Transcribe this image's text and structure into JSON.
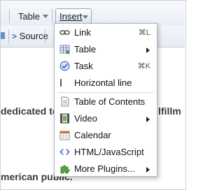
{
  "toolbar": {
    "table_label": "Table",
    "insert_label": "Insert",
    "source_label": "Source"
  },
  "document": {
    "line1_left": "dedicated to",
    "line1_right": "lfillm",
    "line2": "merican public."
  },
  "menu": {
    "items": [
      {
        "label": "Link",
        "shortcut": "⌘L",
        "icon": "link-icon"
      },
      {
        "label": "Table",
        "shortcut": "",
        "icon": "table-icon",
        "submenu": true
      },
      {
        "label": "Task",
        "shortcut": "⌘K",
        "icon": "task-icon"
      },
      {
        "label": "Horizontal line",
        "shortcut": "",
        "icon": "horizontal-line-icon"
      },
      {
        "label": "Table of Contents",
        "shortcut": "",
        "icon": "toc-icon"
      },
      {
        "label": "Video",
        "shortcut": "",
        "icon": "video-icon",
        "submenu": true
      },
      {
        "label": "Calendar",
        "shortcut": "",
        "icon": "calendar-icon"
      },
      {
        "label": "HTML/JavaScript",
        "shortcut": "",
        "icon": "code-icon"
      },
      {
        "label": "More Plugins...",
        "shortcut": "",
        "icon": "puzzle-icon",
        "submenu": true
      }
    ]
  },
  "colors": {
    "toolbar_bg": "#e9eef5",
    "menu_border": "#a9b4c2",
    "accent_blue": "#3b6fb6",
    "puzzle_green": "#5aa03a"
  }
}
